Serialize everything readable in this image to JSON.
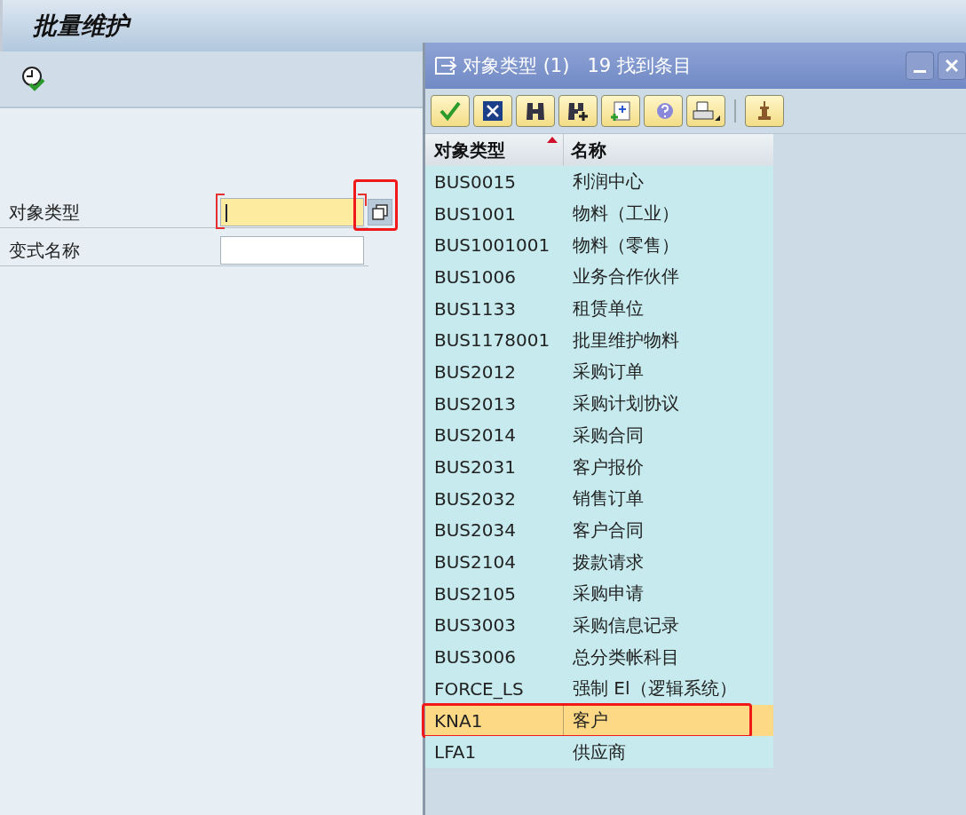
{
  "window": {
    "title": "批量维护"
  },
  "form": {
    "fields": [
      {
        "label": "对象类型",
        "required": true,
        "focused": true,
        "value_help": true,
        "highlighted": true
      },
      {
        "label": "变式名称",
        "required": false,
        "focused": false,
        "value_help": false,
        "highlighted": false
      }
    ]
  },
  "popup": {
    "title": "对象类型 (1)   19 找到条目",
    "columns": [
      {
        "label": "对象类型",
        "sorted": true
      },
      {
        "label": "名称",
        "sorted": false
      }
    ],
    "rows": [
      {
        "cells": [
          "BUS0015",
          "利润中心"
        ],
        "selected": false,
        "highlighted": false
      },
      {
        "cells": [
          "BUS1001",
          "物料（工业）"
        ],
        "selected": false,
        "highlighted": false
      },
      {
        "cells": [
          "BUS1001001",
          "物料（零售）"
        ],
        "selected": false,
        "highlighted": false
      },
      {
        "cells": [
          "BUS1006",
          "业务合作伙伴"
        ],
        "selected": false,
        "highlighted": false
      },
      {
        "cells": [
          "BUS1133",
          "租赁单位"
        ],
        "selected": false,
        "highlighted": false
      },
      {
        "cells": [
          "BUS1178001",
          "批里维护物料"
        ],
        "selected": false,
        "highlighted": false
      },
      {
        "cells": [
          "BUS2012",
          "采购订单"
        ],
        "selected": false,
        "highlighted": false
      },
      {
        "cells": [
          "BUS2013",
          "采购计划协议"
        ],
        "selected": false,
        "highlighted": false
      },
      {
        "cells": [
          "BUS2014",
          "采购合同"
        ],
        "selected": false,
        "highlighted": false
      },
      {
        "cells": [
          "BUS2031",
          "客户报价"
        ],
        "selected": false,
        "highlighted": false
      },
      {
        "cells": [
          "BUS2032",
          "销售订单"
        ],
        "selected": false,
        "highlighted": false
      },
      {
        "cells": [
          "BUS2034",
          "客户合同"
        ],
        "selected": false,
        "highlighted": false
      },
      {
        "cells": [
          "BUS2104",
          "拨款请求"
        ],
        "selected": false,
        "highlighted": false
      },
      {
        "cells": [
          "BUS2105",
          "采购申请"
        ],
        "selected": false,
        "highlighted": false
      },
      {
        "cells": [
          "BUS3003",
          "采购信息记录"
        ],
        "selected": false,
        "highlighted": false
      },
      {
        "cells": [
          "BUS3006",
          "总分类帐科目"
        ],
        "selected": false,
        "highlighted": false
      },
      {
        "cells": [
          "FORCE_LS",
          "强制 El（逻辑系统）"
        ],
        "selected": false,
        "highlighted": false
      },
      {
        "cells": [
          "KNA1",
          "客户"
        ],
        "selected": true,
        "highlighted": true
      },
      {
        "cells": [
          "LFA1",
          "供应商"
        ],
        "selected": false,
        "highlighted": false
      }
    ]
  }
}
